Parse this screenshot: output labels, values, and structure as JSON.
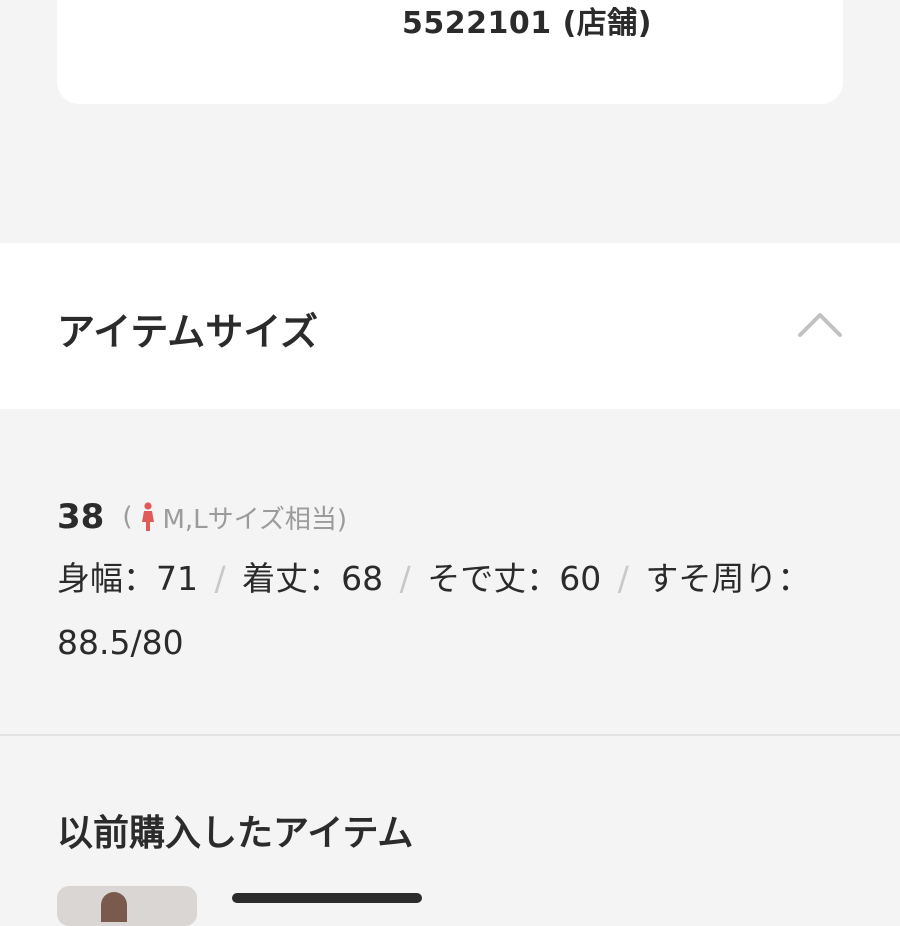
{
  "store": {
    "code_text": "5522101 (店舗)"
  },
  "item_size": {
    "title": "アイテムサイズ",
    "collapse_icon": "chevron-up-icon",
    "size": "38",
    "note_open": "(",
    "note_icon": "woman-icon",
    "note_text": "M,Lサイズ相当)",
    "note_icon_color": "#e05a5a",
    "measurements": [
      {
        "label": "身幅：71"
      },
      {
        "label": "着丈：68"
      },
      {
        "label": "そで丈：60"
      },
      {
        "label": "すそ周り："
      }
    ],
    "separator": "/",
    "hem_value": "88.5/80"
  },
  "previous_items": {
    "title": "以前購入したアイテム"
  }
}
